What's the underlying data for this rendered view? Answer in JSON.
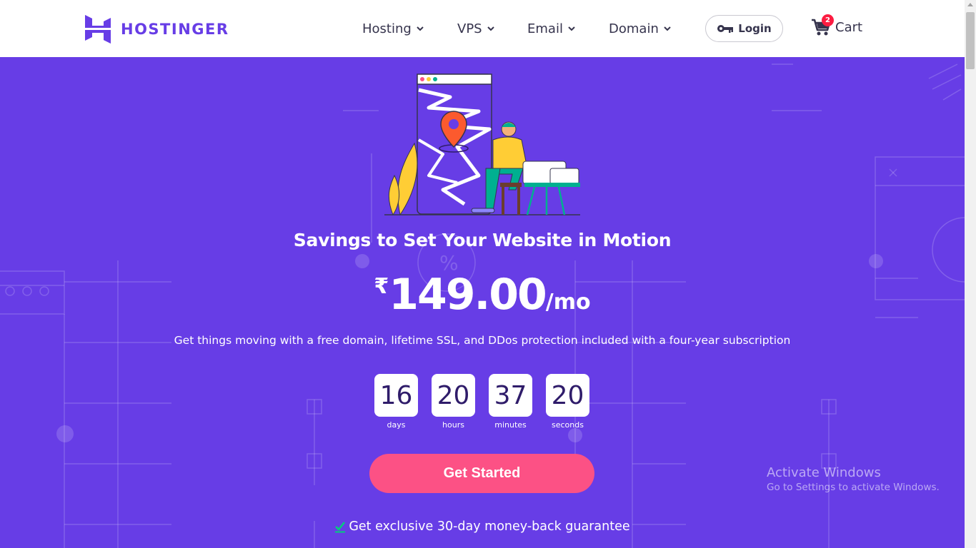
{
  "brand": {
    "name": "HOSTINGER",
    "color": "#673de6"
  },
  "nav": {
    "items": [
      {
        "label": "Hosting"
      },
      {
        "label": "VPS"
      },
      {
        "label": "Email"
      },
      {
        "label": "Domain"
      }
    ],
    "login_label": "Login",
    "cart_label": "Cart",
    "cart_count": "2"
  },
  "hero": {
    "title": "Savings to Set Your Website in Motion",
    "price_currency": "₹",
    "price_amount": "149.00",
    "price_period": "/mo",
    "subtitle": "Get things moving with a free domain, lifetime SSL, and DDos protection included with a four-year subscription",
    "countdown": [
      {
        "value": "16",
        "label": "days"
      },
      {
        "value": "20",
        "label": "hours"
      },
      {
        "value": "37",
        "label": "minutes"
      },
      {
        "value": "20",
        "label": "seconds"
      }
    ],
    "cta_label": "Get Started",
    "guarantee": "Get exclusive 30-day money-back guarantee"
  },
  "watermark": {
    "line1": "Activate Windows",
    "line2": "Go to Settings to activate Windows."
  },
  "colors": {
    "hero_bg": "#673de6",
    "cta": "#fc5185",
    "badge": "#fc1c41",
    "check": "#00b090"
  },
  "icons": {
    "key": "key-icon",
    "cart": "cart-icon",
    "chevron": "chevron-down-icon",
    "check": "check-icon"
  }
}
